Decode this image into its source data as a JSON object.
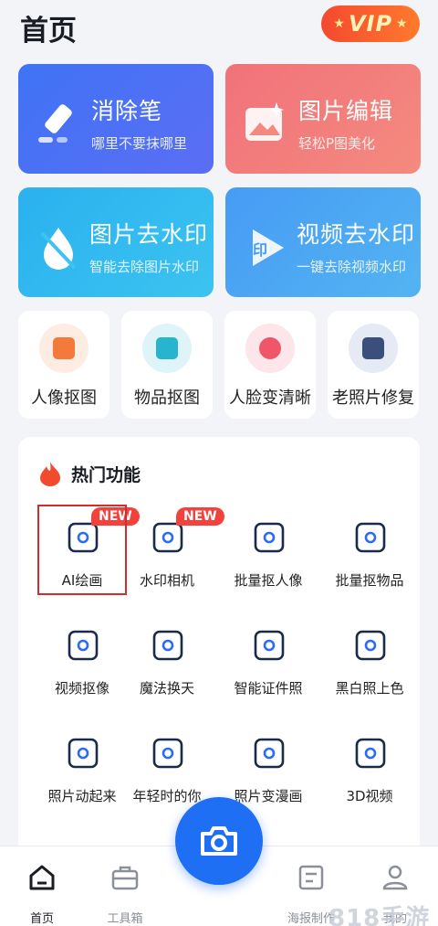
{
  "header": {
    "title": "首页",
    "vip_label": "VIP"
  },
  "top_cards": [
    {
      "title": "消除笔",
      "subtitle": "哪里不要抹哪里",
      "icon": "eraser-pen-icon"
    },
    {
      "title": "图片编辑",
      "subtitle": "轻松P图美化",
      "icon": "image-edit-icon"
    },
    {
      "title": "图片去水印",
      "subtitle": "智能去除图片水印",
      "icon": "image-watermark-remove-icon"
    },
    {
      "title": "视频去水印",
      "subtitle": "一键去除视频水印",
      "icon": "video-watermark-remove-icon"
    }
  ],
  "quick_tools": [
    {
      "label": "人像抠图",
      "icon": "portrait-cutout-icon",
      "color": "#f47a3c",
      "bg": "#fdece2"
    },
    {
      "label": "物品抠图",
      "icon": "object-cutout-icon",
      "color": "#27b4cf",
      "bg": "#dff4f8"
    },
    {
      "label": "人脸变清晰",
      "icon": "face-enhance-icon",
      "color": "#f05669",
      "bg": "#fde6ea"
    },
    {
      "label": "老照片修复",
      "icon": "old-photo-repair-icon",
      "color": "#3b4f7d",
      "bg": "#e6eaf4"
    }
  ],
  "hot": {
    "title": "热门功能",
    "items": [
      {
        "label": "AI绘画",
        "badge": "NEW",
        "icon": "ai-painting-icon"
      },
      {
        "label": "水印相机",
        "badge": "NEW",
        "icon": "watermark-camera-icon"
      },
      {
        "label": "批量抠人像",
        "icon": "batch-portrait-icon"
      },
      {
        "label": "批量抠物品",
        "icon": "batch-object-icon"
      },
      {
        "label": "视频抠像",
        "icon": "video-cutout-icon"
      },
      {
        "label": "魔法换天",
        "icon": "sky-replace-icon"
      },
      {
        "label": "智能证件照",
        "icon": "id-photo-icon"
      },
      {
        "label": "黑白照上色",
        "icon": "colorize-icon"
      },
      {
        "label": "照片动起来",
        "icon": "animate-photo-icon"
      },
      {
        "label": "年轻时的你",
        "icon": "young-face-icon"
      },
      {
        "label": "照片变漫画",
        "icon": "cartoon-icon"
      },
      {
        "label": "3D视频",
        "icon": "3d-video-icon"
      }
    ]
  },
  "tabbar": {
    "items": [
      {
        "label": "首页",
        "icon": "home-icon",
        "active": true
      },
      {
        "label": "工具箱",
        "icon": "toolbox-icon"
      },
      {
        "label": "海报制作",
        "icon": "poster-icon"
      },
      {
        "label": "我的",
        "icon": "profile-icon"
      }
    ],
    "camera_icon": "camera-icon"
  },
  "watermark": "818手游网",
  "colors": {
    "accent": "#1f6ff5",
    "badge": "#f2423b",
    "vip": "#f4492f"
  }
}
